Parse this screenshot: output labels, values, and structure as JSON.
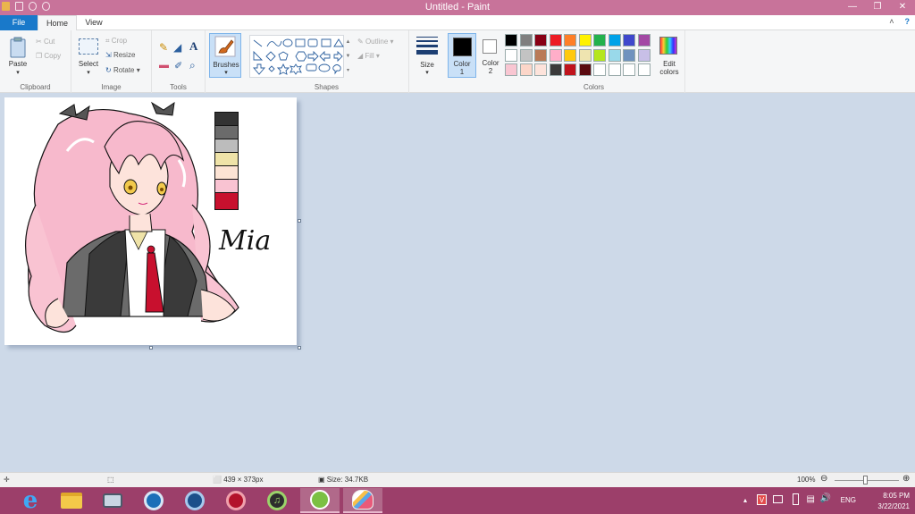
{
  "window": {
    "title": "Untitled - Paint"
  },
  "tabs": {
    "file": "File",
    "home": "Home",
    "view": "View"
  },
  "ribbon": {
    "clipboard": {
      "paste": "Paste",
      "cut": "Cut",
      "copy": "Copy",
      "label": "Clipboard"
    },
    "image": {
      "select": "Select",
      "crop": "Crop",
      "resize": "Resize",
      "rotate": "Rotate",
      "label": "Image"
    },
    "tools": {
      "label": "Tools"
    },
    "brushes": {
      "label": "Brushes"
    },
    "shapes": {
      "outline": "Outline",
      "fill": "Fill",
      "label": "Shapes"
    },
    "size": {
      "label": "Size"
    },
    "color1": {
      "label": "Color",
      "num": "1",
      "value": "#000000"
    },
    "color2": {
      "label": "Color",
      "num": "2",
      "value": "#ffffff"
    },
    "colors": {
      "label": "Colors",
      "edit_line1": "Edit",
      "edit_line2": "colors"
    },
    "palette_row1": [
      "#000000",
      "#7f7f7f",
      "#880015",
      "#ed1c24",
      "#ff7f27",
      "#fff200",
      "#22b14c",
      "#00a2e8",
      "#3f48cc",
      "#a349a4"
    ],
    "palette_row2": [
      "#ffffff",
      "#c3c3c3",
      "#b97a57",
      "#ffaec9",
      "#ffc90e",
      "#efe4b0",
      "#b5e61d",
      "#99d9ea",
      "#7092be",
      "#c8bfe7"
    ],
    "palette_row3": [
      "#f9c6d2",
      "#fcd6c9",
      "#fde3db",
      "#3a3a3a",
      "#c0141c",
      "#5a0a10",
      "#ffffff",
      "#ffffff",
      "#ffffff",
      "#ffffff"
    ]
  },
  "canvas": {
    "signature": "Mia",
    "swatches": [
      "#333333",
      "#6b6b6b",
      "#bcbcbc",
      "#efe3a8",
      "#fce3d4",
      "#f9c3d2",
      "#c8102e"
    ]
  },
  "status": {
    "dimensions": "439 × 373px",
    "size": "Size: 34.7KB",
    "zoom": "100%"
  },
  "taskbar": {
    "language": "ENG",
    "time": "8:05 PM",
    "date": "3/22/2021"
  }
}
